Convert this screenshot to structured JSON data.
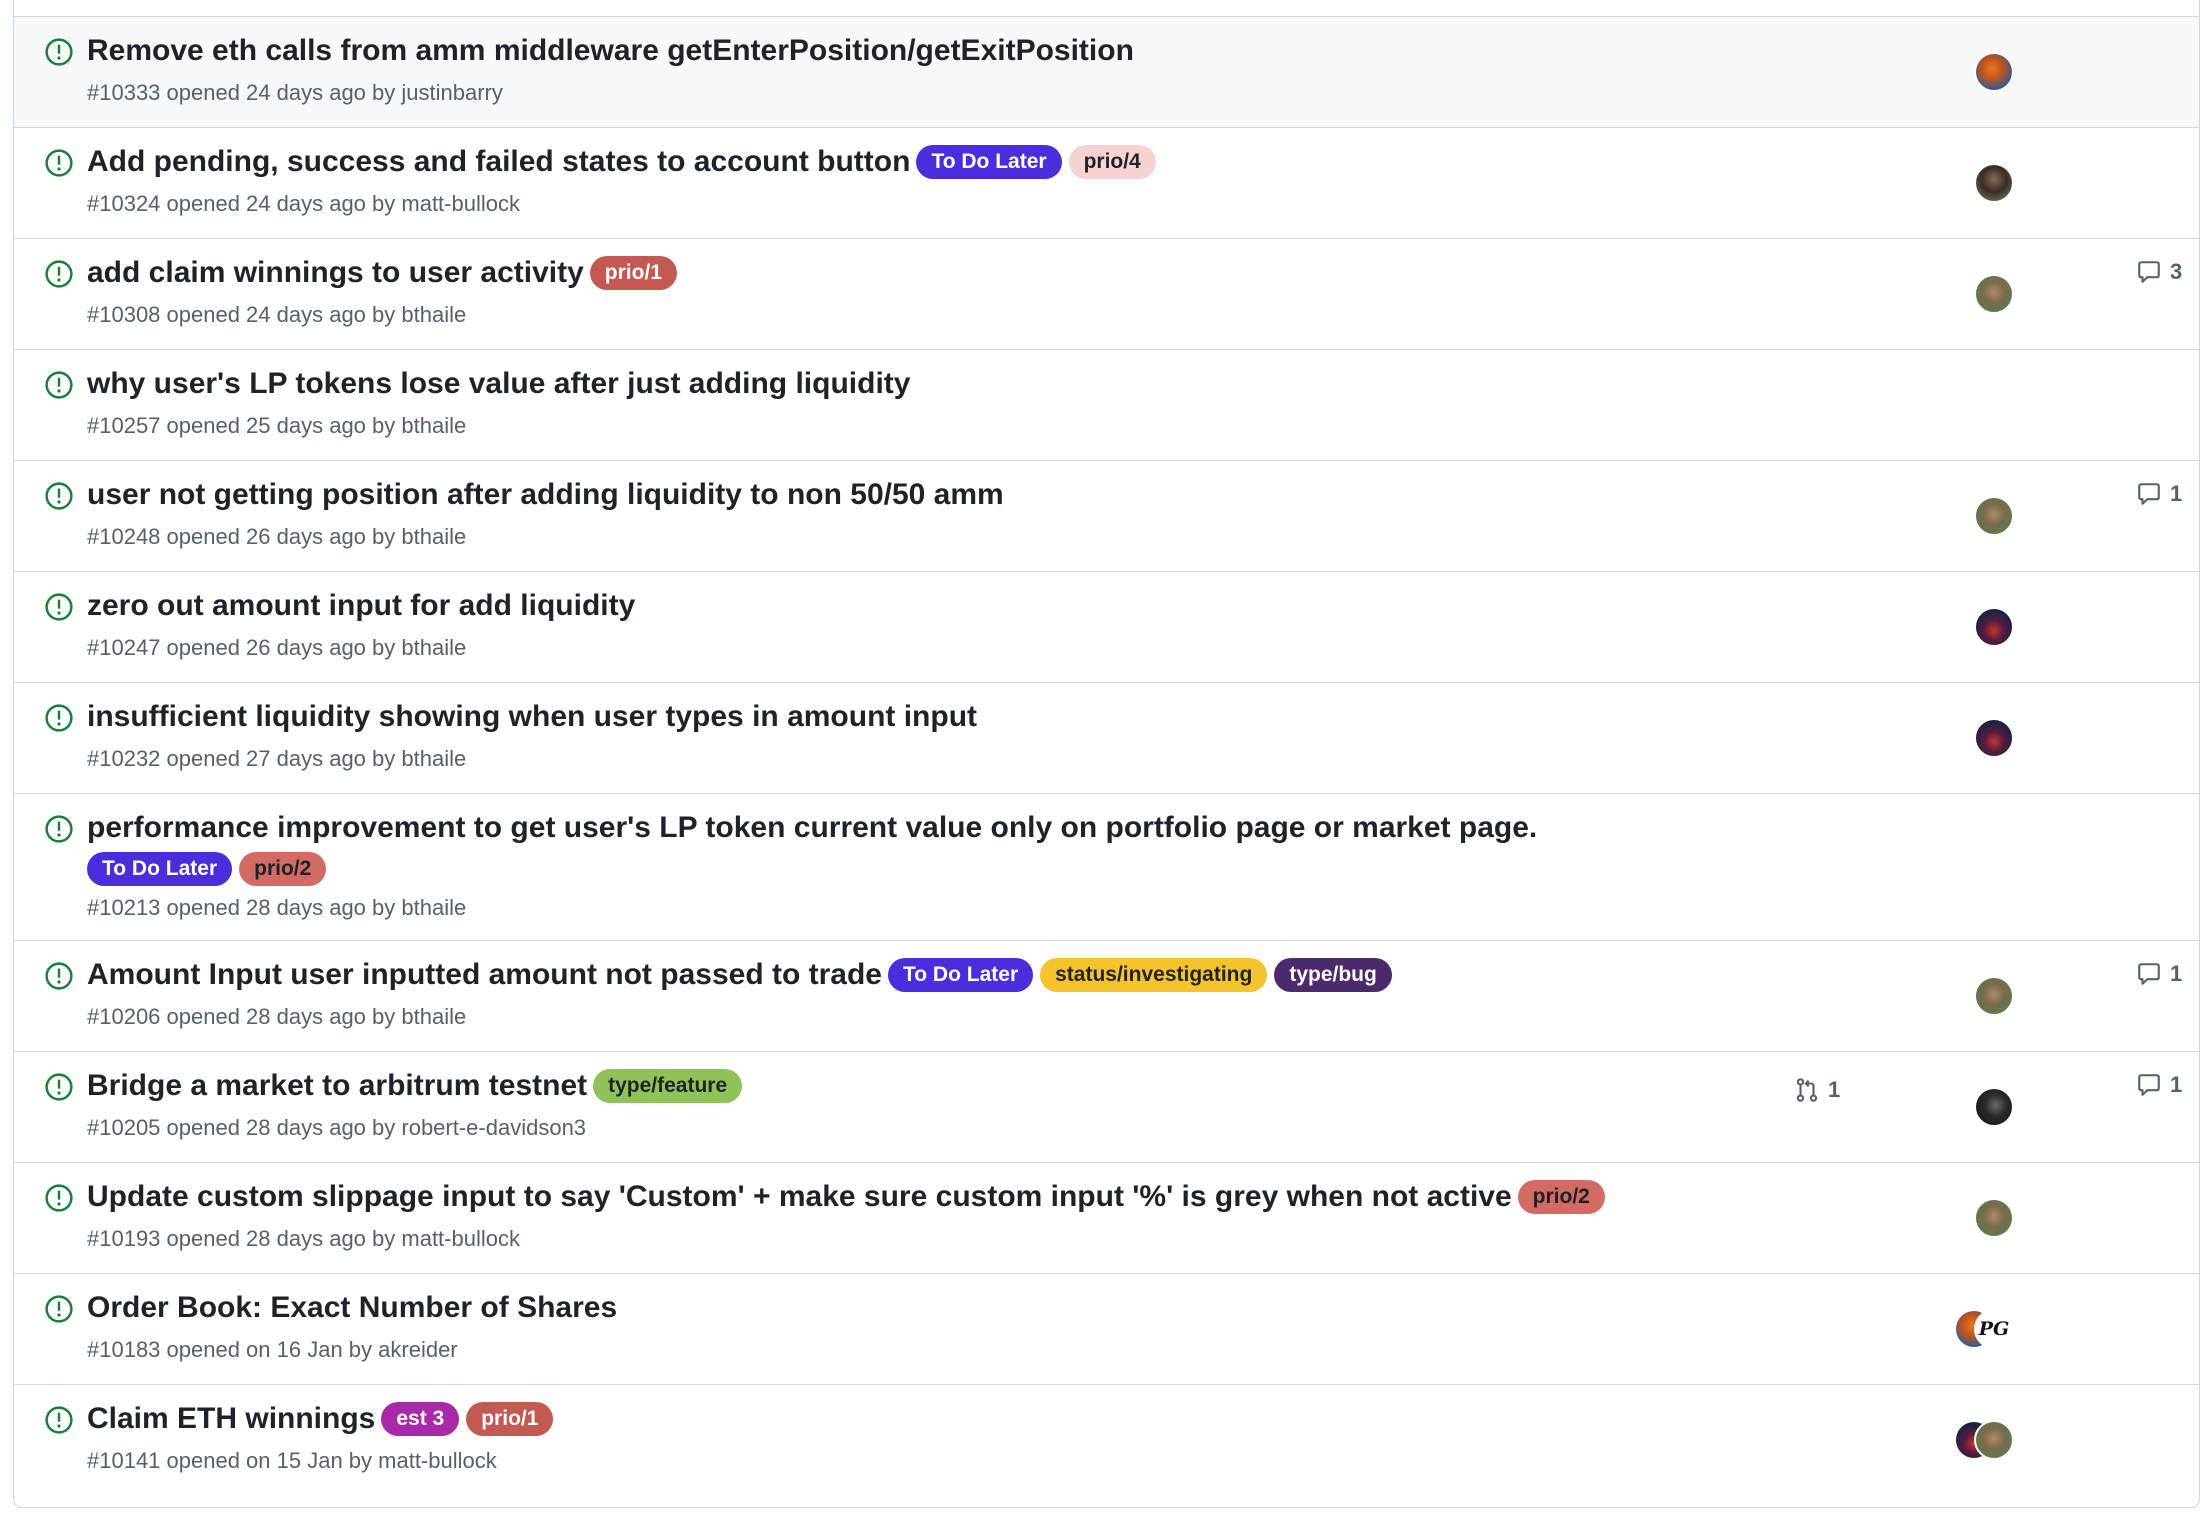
{
  "issues": [
    {
      "title": "Remove eth calls from amm middleware getEnterPosition/getExitPosition",
      "meta": "#10333 opened 24 days ago by justinbarry",
      "labels": [],
      "avatars": [
        "justinbarry"
      ],
      "comments": "",
      "linked_prs": ""
    },
    {
      "title": "Add pending, success and failed states to account button",
      "meta": "#10324 opened 24 days ago by matt-bullock",
      "labels": [
        {
          "name": "To Do Later",
          "bg": "#4b2ddb",
          "fg": "#ffffff"
        },
        {
          "name": "prio/4",
          "bg": "#f6d3d0",
          "fg": "#1f2328"
        }
      ],
      "avatars": [
        "matt-bullock"
      ],
      "comments": "",
      "linked_prs": ""
    },
    {
      "title": "add claim winnings to user activity",
      "meta": "#10308 opened 24 days ago by bthaile",
      "labels": [
        {
          "name": "prio/1",
          "bg": "#c35a52",
          "fg": "#ffffff"
        }
      ],
      "avatars": [
        "bthaile"
      ],
      "comments": "3",
      "linked_prs": ""
    },
    {
      "title": "why user's LP tokens lose value after just adding liquidity",
      "meta": "#10257 opened 25 days ago by bthaile",
      "labels": [],
      "avatars": [],
      "comments": "",
      "linked_prs": ""
    },
    {
      "title": "user not getting position after adding liquidity to non 50/50 amm",
      "meta": "#10248 opened 26 days ago by bthaile",
      "labels": [],
      "avatars": [
        "bthaile"
      ],
      "comments": "1",
      "linked_prs": ""
    },
    {
      "title": "zero out amount input for add liquidity",
      "meta": "#10247 opened 26 days ago by bthaile",
      "labels": [],
      "avatars": [
        "dark-space"
      ],
      "comments": "",
      "linked_prs": ""
    },
    {
      "title": "insufficient liquidity showing when user types in amount input",
      "meta": "#10232 opened 27 days ago by bthaile",
      "labels": [],
      "avatars": [
        "dark-space"
      ],
      "comments": "",
      "linked_prs": ""
    },
    {
      "title": "performance improvement to get user's LP token current value only on portfolio page or market page.",
      "meta": "#10213 opened 28 days ago by bthaile",
      "labels": [
        {
          "name": "To Do Later",
          "bg": "#4b2ddb",
          "fg": "#ffffff"
        },
        {
          "name": "prio/2",
          "bg": "#d26b63",
          "fg": "#1f2328"
        }
      ],
      "labels_on_new_line": true,
      "avatars": [],
      "comments": "",
      "linked_prs": ""
    },
    {
      "title": "Amount Input user inputted amount not passed to trade",
      "meta": "#10206 opened 28 days ago by bthaile",
      "labels": [
        {
          "name": "To Do Later",
          "bg": "#4b2ddb",
          "fg": "#ffffff"
        },
        {
          "name": "status/investigating",
          "bg": "#f5c32c",
          "fg": "#1f2328"
        },
        {
          "name": "type/bug",
          "bg": "#4a2a6b",
          "fg": "#ffffff"
        }
      ],
      "avatars": [
        "bthaile"
      ],
      "comments": "1",
      "linked_prs": ""
    },
    {
      "title": "Bridge a market to arbitrum testnet",
      "meta": "#10205 opened 28 days ago by robert-e-davidson3",
      "labels": [
        {
          "name": "type/feature",
          "bg": "#8fc259",
          "fg": "#1f2328"
        }
      ],
      "avatars": [
        "robert-e-davidson3"
      ],
      "comments": "1",
      "linked_prs": "1"
    },
    {
      "title": "Update custom slippage input to say 'Custom' + make sure custom input '%' is grey when not active",
      "meta": "#10193 opened 28 days ago by matt-bullock",
      "labels": [
        {
          "name": "prio/2",
          "bg": "#d26b63",
          "fg": "#1f2328"
        }
      ],
      "avatars": [
        "bthaile"
      ],
      "comments": "",
      "linked_prs": ""
    },
    {
      "title": "Order Book: Exact Number of Shares",
      "meta": "#10183 opened on 16 Jan by akreider",
      "labels": [],
      "avatars": [
        "justinbarry",
        "pg"
      ],
      "comments": "",
      "linked_prs": ""
    },
    {
      "title": "Claim ETH winnings",
      "meta": "#10141 opened on 15 Jan by matt-bullock",
      "labels": [
        {
          "name": "est 3",
          "bg": "#a82aa8",
          "fg": "#ffffff"
        },
        {
          "name": "prio/1",
          "bg": "#c35a52",
          "fg": "#ffffff"
        }
      ],
      "avatars": [
        "dark-space",
        "bthaile"
      ],
      "comments": "",
      "linked_prs": ""
    }
  ],
  "colors": {
    "open_icon": "#1a7f37",
    "border": "#d0d7de",
    "muted_text": "#57606a"
  },
  "icons": {
    "status": "issue-opened-icon",
    "comment": "comment-icon",
    "pull_request": "git-pull-request-icon"
  }
}
